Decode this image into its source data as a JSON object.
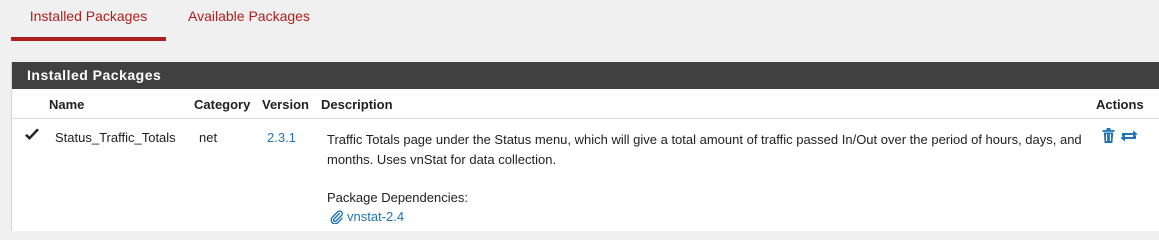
{
  "tabs": {
    "installed_label": "Installed Packages",
    "available_label": "Available Packages"
  },
  "panel": {
    "title": "Installed Packages",
    "columns": {
      "name": "Name",
      "category": "Category",
      "version": "Version",
      "description": "Description",
      "actions": "Actions"
    },
    "rows": [
      {
        "status_icon": "check-icon",
        "name": "Status_Traffic_Totals",
        "category": "net",
        "version": "2.3.1",
        "description": "Traffic Totals page under the Status menu, which will give a total amount of traffic passed In/Out over the period of hours, days, and months. Uses vnStat for data collection.",
        "dependencies_label": "Package Dependencies:",
        "dependency": "vnstat-2.4",
        "actions": [
          "trash-icon",
          "refresh-icon"
        ]
      }
    ]
  },
  "colors": {
    "accent": "#b01f1f",
    "link": "#1f73b7",
    "panel_heading_bg": "#404040",
    "page_bg": "#f0f0f0"
  }
}
